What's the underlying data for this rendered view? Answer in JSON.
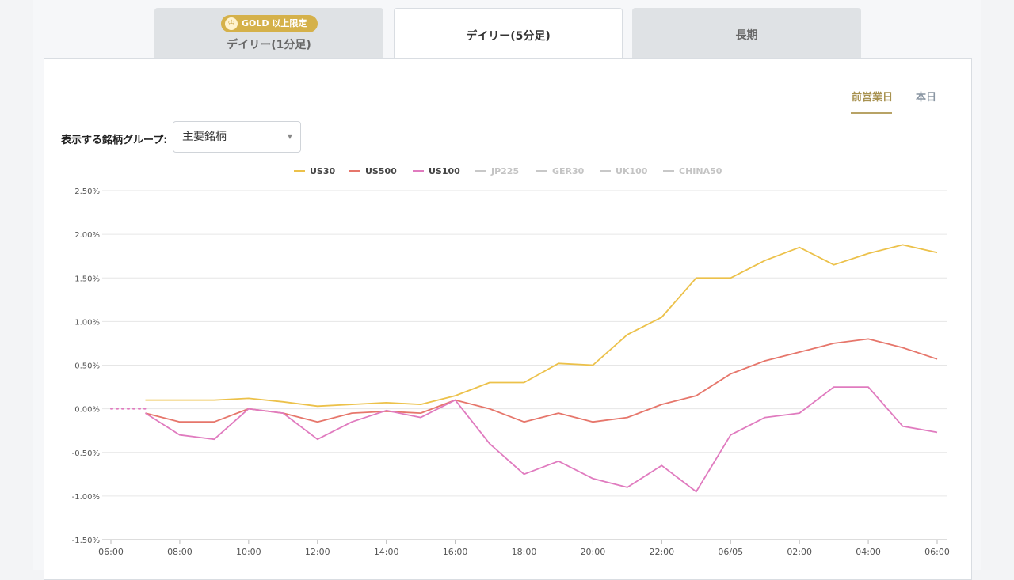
{
  "tabs": [
    {
      "label": "デイリー(1分足)",
      "badge": "GOLD 以上限定",
      "active": false
    },
    {
      "label": "デイリー(5分足)",
      "active": true
    },
    {
      "label": "長期",
      "active": false
    }
  ],
  "periods": [
    {
      "label": "前営業日",
      "active": true
    },
    {
      "label": "本日",
      "active": false
    }
  ],
  "group_selector": {
    "label": "表示する銘柄グループ:",
    "value": "主要銘柄"
  },
  "icons": {
    "badge": "crown-icon",
    "select": "dropdown-caret-icon"
  },
  "colors": {
    "gold": "#d5b14a",
    "accent": "#a89250",
    "US30": "#ecc14a",
    "US500": "#e6766b",
    "US100": "#e07bbf",
    "hidden": "#c8c8c8"
  },
  "chart_data": {
    "type": "line",
    "title": "",
    "xlabel": "",
    "ylabel": "",
    "ylim": [
      -1.5,
      2.5
    ],
    "yticks": [
      "2.50%",
      "2.00%",
      "1.50%",
      "1.00%",
      "0.50%",
      "0.00%",
      "-0.50%",
      "-1.00%",
      "-1.50%"
    ],
    "xticks": [
      "06:00",
      "08:00",
      "10:00",
      "12:00",
      "14:00",
      "16:00",
      "18:00",
      "20:00",
      "22:00",
      "06/05",
      "02:00",
      "04:00",
      "06:00"
    ],
    "grid": true,
    "legend_position": "top",
    "legend": [
      {
        "name": "US30",
        "visible": true
      },
      {
        "name": "US500",
        "visible": true
      },
      {
        "name": "US100",
        "visible": true
      },
      {
        "name": "JP225",
        "visible": false
      },
      {
        "name": "GER30",
        "visible": false
      },
      {
        "name": "UK100",
        "visible": false
      },
      {
        "name": "CHINA50",
        "visible": false
      }
    ],
    "x": [
      "07:00",
      "08:00",
      "09:00",
      "10:00",
      "11:00",
      "12:00",
      "13:00",
      "14:00",
      "15:00",
      "16:00",
      "17:00",
      "18:00",
      "19:00",
      "20:00",
      "21:00",
      "22:00",
      "23:00",
      "06/05 00:00",
      "01:00",
      "02:00",
      "03:00",
      "04:00",
      "05:00",
      "06:00"
    ],
    "pre_session": {
      "x": [
        "06:00",
        "07:00"
      ],
      "value": 0.0
    },
    "series": [
      {
        "name": "US30",
        "values": [
          0.1,
          0.1,
          0.1,
          0.12,
          0.08,
          0.03,
          0.05,
          0.07,
          0.05,
          0.15,
          0.3,
          0.3,
          0.52,
          0.5,
          0.85,
          1.05,
          1.5,
          1.5,
          1.7,
          1.85,
          1.65,
          1.78,
          1.88,
          1.79
        ]
      },
      {
        "name": "US500",
        "values": [
          -0.05,
          -0.15,
          -0.15,
          0.0,
          -0.05,
          -0.15,
          -0.05,
          -0.03,
          -0.05,
          0.1,
          0.0,
          -0.15,
          -0.05,
          -0.15,
          -0.1,
          0.05,
          0.15,
          0.4,
          0.55,
          0.65,
          0.75,
          0.8,
          0.7,
          0.57
        ]
      },
      {
        "name": "US100",
        "values": [
          -0.05,
          -0.3,
          -0.35,
          0.0,
          -0.05,
          -0.35,
          -0.15,
          -0.02,
          -0.1,
          0.1,
          -0.4,
          -0.75,
          -0.6,
          -0.8,
          -0.9,
          -0.65,
          -0.95,
          -0.3,
          -0.1,
          -0.05,
          0.25,
          0.25,
          -0.2,
          -0.27
        ]
      }
    ]
  }
}
